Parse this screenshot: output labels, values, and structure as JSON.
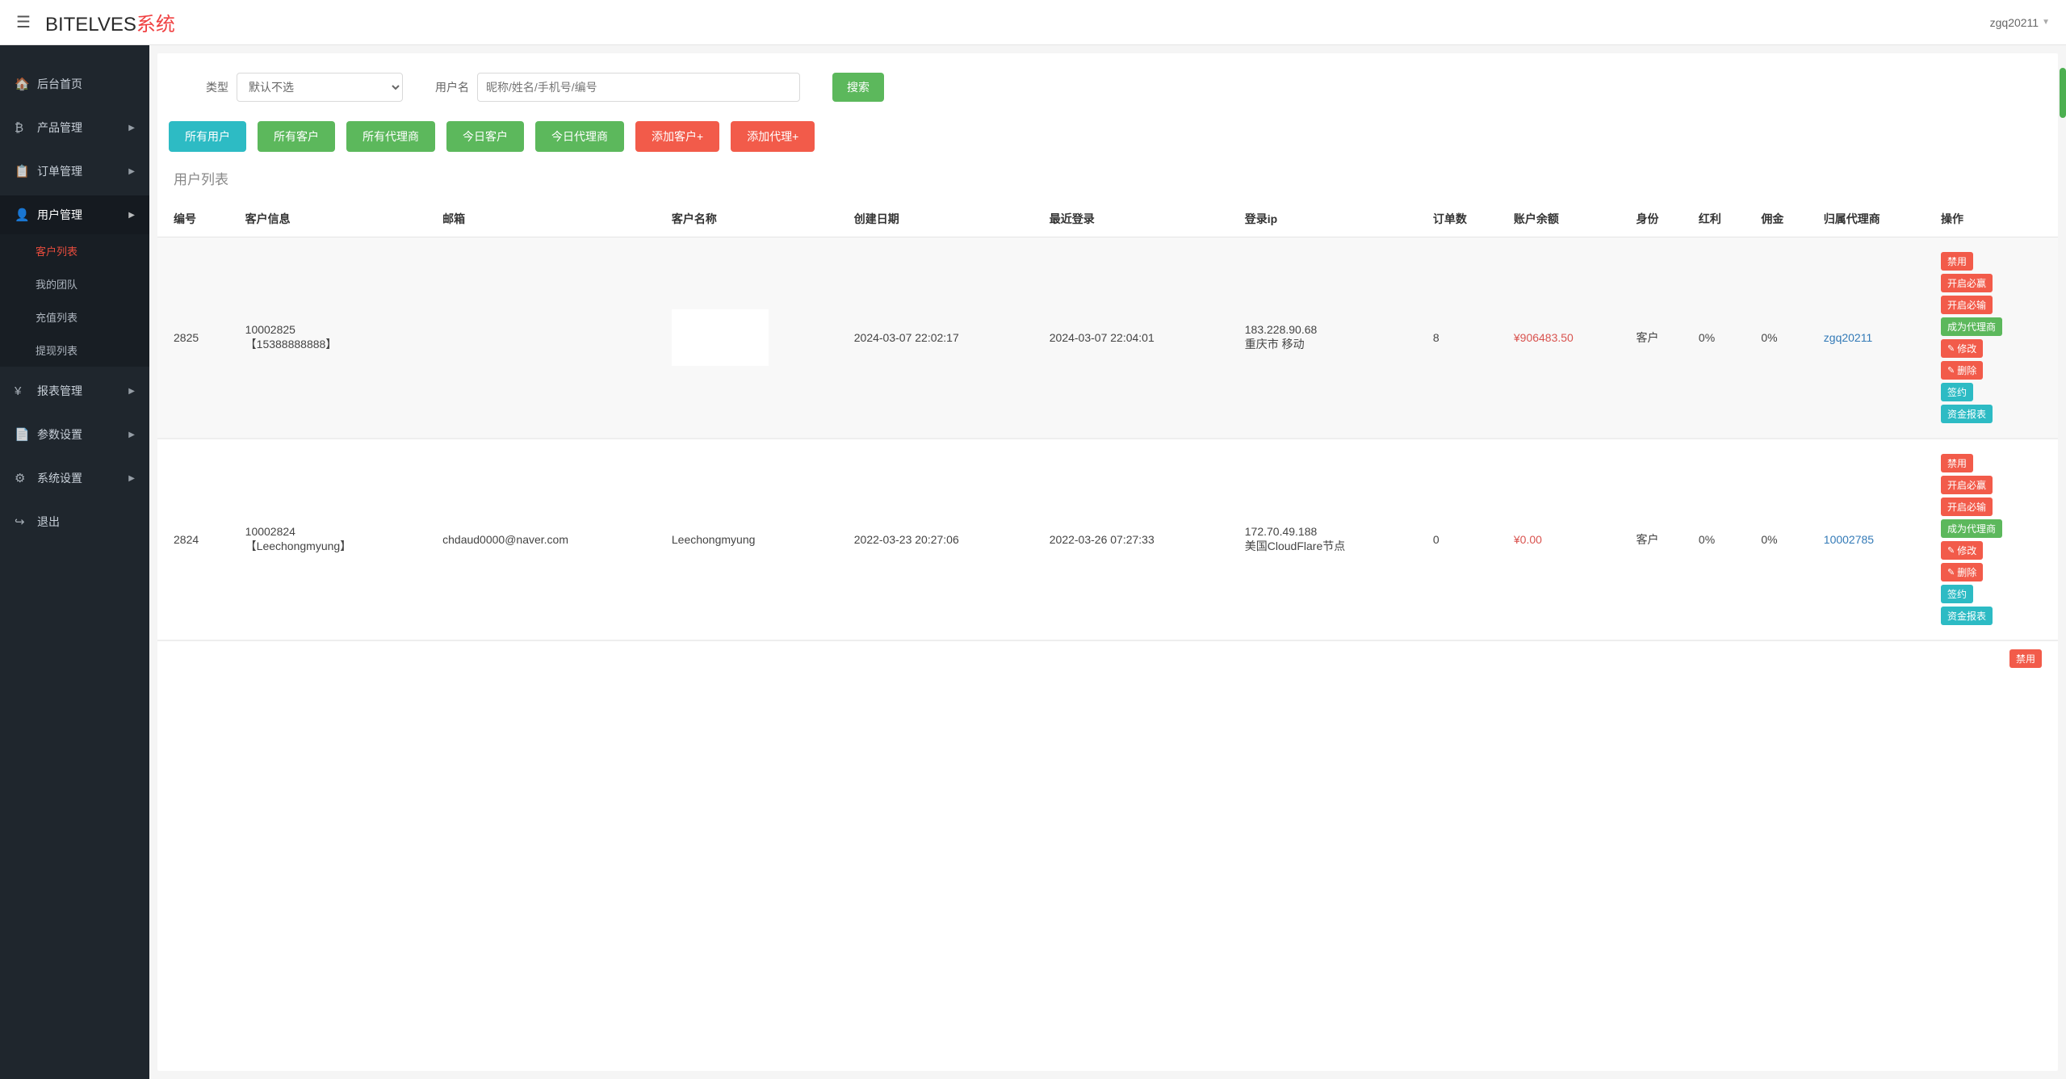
{
  "header": {
    "brand_part1": "BITELVES",
    "brand_part2": "系统",
    "username": "zgq20211"
  },
  "sidebar": {
    "items": [
      {
        "icon": "🏠",
        "label": "后台首页",
        "has_sub": false
      },
      {
        "icon": "₿",
        "label": "产品管理",
        "has_sub": true
      },
      {
        "icon": "📋",
        "label": "订单管理",
        "has_sub": true
      },
      {
        "icon": "👤",
        "label": "用户管理",
        "has_sub": true,
        "active": true,
        "sub": [
          {
            "label": "客户列表",
            "selected": true
          },
          {
            "label": "我的团队"
          },
          {
            "label": "充值列表"
          },
          {
            "label": "提现列表"
          }
        ]
      },
      {
        "icon": "¥",
        "label": "报表管理",
        "has_sub": true
      },
      {
        "icon": "📄",
        "label": "参数设置",
        "has_sub": true
      },
      {
        "icon": "⚙",
        "label": "系统设置",
        "has_sub": true
      },
      {
        "icon": "↪",
        "label": "退出",
        "has_sub": false
      }
    ]
  },
  "filter": {
    "type_label": "类型",
    "type_default": "默认不选",
    "username_label": "用户名",
    "username_placeholder": "昵称/姓名/手机号/编号",
    "search_btn": "搜索"
  },
  "actions": {
    "all_users": "所有用户",
    "all_customers": "所有客户",
    "all_agents": "所有代理商",
    "today_customers": "今日客户",
    "today_agents": "今日代理商",
    "add_customer": "添加客户+",
    "add_agent": "添加代理+"
  },
  "panel": {
    "title": "用户列表"
  },
  "table": {
    "headers": {
      "id": "编号",
      "info": "客户信息",
      "email": "邮箱",
      "name": "客户名称",
      "created": "创建日期",
      "last_login": "最近登录",
      "login_ip": "登录ip",
      "orders": "订单数",
      "balance": "账户余额",
      "role": "身份",
      "dividend": "红利",
      "commission": "佣金",
      "agent": "归属代理商",
      "ops": "操作"
    },
    "rows": [
      {
        "id": "2825",
        "info": "10002825\n【15388888888】",
        "email": "",
        "name": "",
        "created": "2024-03-07 22:02:17",
        "last_login": "2024-03-07 22:04:01",
        "login_ip": "183.228.90.68\n重庆市 移动",
        "orders": "8",
        "balance": "¥906483.50",
        "role": "客户",
        "dividend": "0%",
        "commission": "0%",
        "agent": "zgq20211"
      },
      {
        "id": "2824",
        "info": "10002824\n【Leechongmyung】",
        "email": "chdaud0000@naver.com",
        "name": "Leechongmyung",
        "created": "2022-03-23 20:27:06",
        "last_login": "2022-03-26 07:27:33",
        "login_ip": "172.70.49.188\n美国CloudFlare节点",
        "orders": "0",
        "balance": "¥0.00",
        "role": "客户",
        "dividend": "0%",
        "commission": "0%",
        "agent": "10002785"
      }
    ],
    "ops": {
      "disable": "禁用",
      "open_win": "开启必赢",
      "open_lose": "开启必输",
      "become_agent": "成为代理商",
      "edit": "修改",
      "delete": "删除",
      "sign": "签约",
      "funds_report": "资金报表"
    }
  }
}
